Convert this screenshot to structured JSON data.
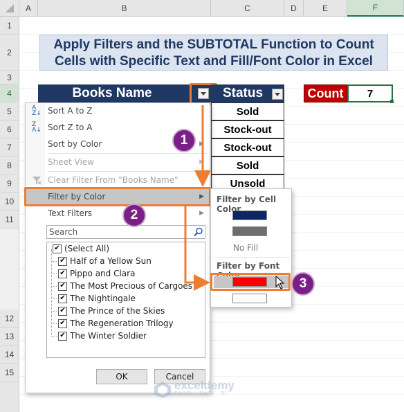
{
  "columns": [
    "A",
    "B",
    "C",
    "D",
    "E",
    "F"
  ],
  "rows": [
    "1",
    "2",
    "3",
    "4",
    "5",
    "6",
    "7",
    "8",
    "9",
    "10",
    "11",
    "12",
    "13",
    "14",
    "15"
  ],
  "title": "Apply Filters and the SUBTOTAL Function to Count Cells with Specific Text and Fill/Font Color in Excel",
  "table": {
    "header_books": "Books Name",
    "header_status": "Status",
    "status_values": [
      "Sold",
      "Stock-out",
      "Stock-out",
      "Sold",
      "Unsold"
    ]
  },
  "count": {
    "label": "Count",
    "value": "7"
  },
  "filter_menu": {
    "items": [
      {
        "label": "Sort A to Z",
        "disabled": false,
        "submenu": false
      },
      {
        "label": "Sort Z to A",
        "disabled": false,
        "submenu": false
      },
      {
        "label": "Sort by Color",
        "disabled": false,
        "submenu": true
      },
      {
        "label": "Sheet View",
        "disabled": true,
        "submenu": true
      },
      {
        "label": "Clear Filter From \"Books Name\"",
        "disabled": true,
        "submenu": false
      },
      {
        "label": "Filter by Color",
        "disabled": false,
        "submenu": true
      },
      {
        "label": "Text Filters",
        "disabled": false,
        "submenu": true
      }
    ],
    "search_placeholder": "Search",
    "list": [
      "(Select All)",
      "Half of a Yellow Sun",
      "Pippo and Clara",
      "The Most Precious of Cargoes",
      "The Nightingale",
      "The Prince of the Skies",
      "The Regeneration Trilogy",
      "The Winter Soldier"
    ],
    "ok": "OK",
    "cancel": "Cancel"
  },
  "color_submenu": {
    "cell_color_title": "Filter by Cell Color",
    "cell_colors": [
      "#0a2767",
      "#6e6e6e"
    ],
    "no_fill": "No Fill",
    "font_color_title": "Filter by Font Color",
    "font_colors": [
      "#ff0000",
      "#ffffff"
    ]
  },
  "badges": [
    "1",
    "2",
    "3"
  ],
  "watermark": {
    "name": "exceldemy",
    "tagline": "EXCEL · DATA · BI"
  },
  "accent_orange": "#ed7d31",
  "count_red": "#c00000"
}
